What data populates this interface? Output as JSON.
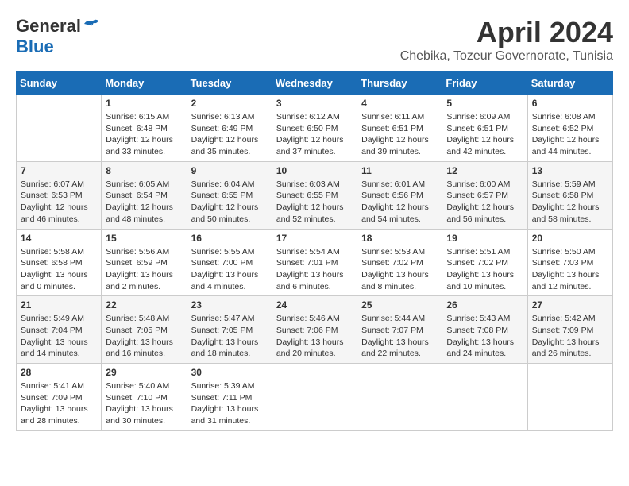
{
  "header": {
    "logo_general": "General",
    "logo_blue": "Blue",
    "month_year": "April 2024",
    "location": "Chebika, Tozeur Governorate, Tunisia"
  },
  "days_of_week": [
    "Sunday",
    "Monday",
    "Tuesday",
    "Wednesday",
    "Thursday",
    "Friday",
    "Saturday"
  ],
  "weeks": [
    [
      {
        "day": "",
        "info": ""
      },
      {
        "day": "1",
        "info": "Sunrise: 6:15 AM\nSunset: 6:48 PM\nDaylight: 12 hours\nand 33 minutes."
      },
      {
        "day": "2",
        "info": "Sunrise: 6:13 AM\nSunset: 6:49 PM\nDaylight: 12 hours\nand 35 minutes."
      },
      {
        "day": "3",
        "info": "Sunrise: 6:12 AM\nSunset: 6:50 PM\nDaylight: 12 hours\nand 37 minutes."
      },
      {
        "day": "4",
        "info": "Sunrise: 6:11 AM\nSunset: 6:51 PM\nDaylight: 12 hours\nand 39 minutes."
      },
      {
        "day": "5",
        "info": "Sunrise: 6:09 AM\nSunset: 6:51 PM\nDaylight: 12 hours\nand 42 minutes."
      },
      {
        "day": "6",
        "info": "Sunrise: 6:08 AM\nSunset: 6:52 PM\nDaylight: 12 hours\nand 44 minutes."
      }
    ],
    [
      {
        "day": "7",
        "info": "Sunrise: 6:07 AM\nSunset: 6:53 PM\nDaylight: 12 hours\nand 46 minutes."
      },
      {
        "day": "8",
        "info": "Sunrise: 6:05 AM\nSunset: 6:54 PM\nDaylight: 12 hours\nand 48 minutes."
      },
      {
        "day": "9",
        "info": "Sunrise: 6:04 AM\nSunset: 6:55 PM\nDaylight: 12 hours\nand 50 minutes."
      },
      {
        "day": "10",
        "info": "Sunrise: 6:03 AM\nSunset: 6:55 PM\nDaylight: 12 hours\nand 52 minutes."
      },
      {
        "day": "11",
        "info": "Sunrise: 6:01 AM\nSunset: 6:56 PM\nDaylight: 12 hours\nand 54 minutes."
      },
      {
        "day": "12",
        "info": "Sunrise: 6:00 AM\nSunset: 6:57 PM\nDaylight: 12 hours\nand 56 minutes."
      },
      {
        "day": "13",
        "info": "Sunrise: 5:59 AM\nSunset: 6:58 PM\nDaylight: 12 hours\nand 58 minutes."
      }
    ],
    [
      {
        "day": "14",
        "info": "Sunrise: 5:58 AM\nSunset: 6:58 PM\nDaylight: 13 hours\nand 0 minutes."
      },
      {
        "day": "15",
        "info": "Sunrise: 5:56 AM\nSunset: 6:59 PM\nDaylight: 13 hours\nand 2 minutes."
      },
      {
        "day": "16",
        "info": "Sunrise: 5:55 AM\nSunset: 7:00 PM\nDaylight: 13 hours\nand 4 minutes."
      },
      {
        "day": "17",
        "info": "Sunrise: 5:54 AM\nSunset: 7:01 PM\nDaylight: 13 hours\nand 6 minutes."
      },
      {
        "day": "18",
        "info": "Sunrise: 5:53 AM\nSunset: 7:02 PM\nDaylight: 13 hours\nand 8 minutes."
      },
      {
        "day": "19",
        "info": "Sunrise: 5:51 AM\nSunset: 7:02 PM\nDaylight: 13 hours\nand 10 minutes."
      },
      {
        "day": "20",
        "info": "Sunrise: 5:50 AM\nSunset: 7:03 PM\nDaylight: 13 hours\nand 12 minutes."
      }
    ],
    [
      {
        "day": "21",
        "info": "Sunrise: 5:49 AM\nSunset: 7:04 PM\nDaylight: 13 hours\nand 14 minutes."
      },
      {
        "day": "22",
        "info": "Sunrise: 5:48 AM\nSunset: 7:05 PM\nDaylight: 13 hours\nand 16 minutes."
      },
      {
        "day": "23",
        "info": "Sunrise: 5:47 AM\nSunset: 7:05 PM\nDaylight: 13 hours\nand 18 minutes."
      },
      {
        "day": "24",
        "info": "Sunrise: 5:46 AM\nSunset: 7:06 PM\nDaylight: 13 hours\nand 20 minutes."
      },
      {
        "day": "25",
        "info": "Sunrise: 5:44 AM\nSunset: 7:07 PM\nDaylight: 13 hours\nand 22 minutes."
      },
      {
        "day": "26",
        "info": "Sunrise: 5:43 AM\nSunset: 7:08 PM\nDaylight: 13 hours\nand 24 minutes."
      },
      {
        "day": "27",
        "info": "Sunrise: 5:42 AM\nSunset: 7:09 PM\nDaylight: 13 hours\nand 26 minutes."
      }
    ],
    [
      {
        "day": "28",
        "info": "Sunrise: 5:41 AM\nSunset: 7:09 PM\nDaylight: 13 hours\nand 28 minutes."
      },
      {
        "day": "29",
        "info": "Sunrise: 5:40 AM\nSunset: 7:10 PM\nDaylight: 13 hours\nand 30 minutes."
      },
      {
        "day": "30",
        "info": "Sunrise: 5:39 AM\nSunset: 7:11 PM\nDaylight: 13 hours\nand 31 minutes."
      },
      {
        "day": "",
        "info": ""
      },
      {
        "day": "",
        "info": ""
      },
      {
        "day": "",
        "info": ""
      },
      {
        "day": "",
        "info": ""
      }
    ]
  ]
}
